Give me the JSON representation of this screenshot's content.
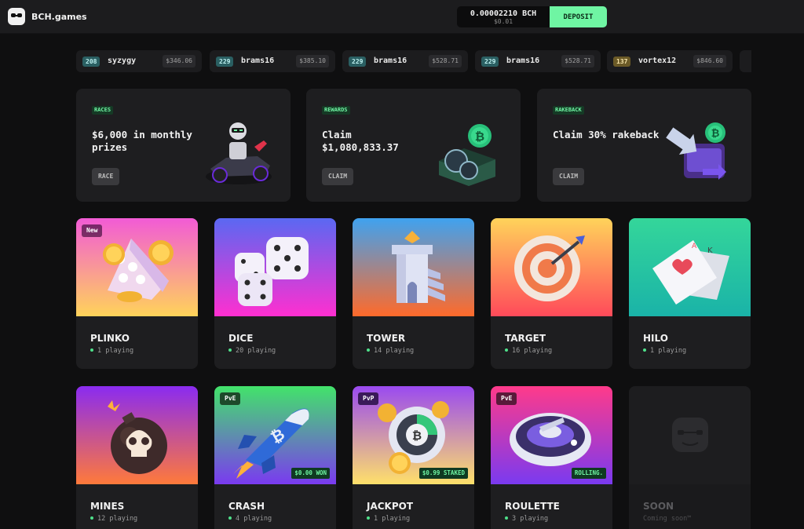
{
  "header": {
    "brand": "BCH.games",
    "balance_bch": "0.00002210 BCH",
    "balance_usd": "$0.01",
    "deposit_label": "DEPOSIT"
  },
  "ticker": [
    {
      "level": "208",
      "user": "syzygy",
      "amount": "$346.06",
      "level_color": "teal"
    },
    {
      "level": "229",
      "user": "brams16",
      "amount": "$385.10",
      "level_color": "teal"
    },
    {
      "level": "229",
      "user": "brams16",
      "amount": "$528.71",
      "level_color": "teal"
    },
    {
      "level": "229",
      "user": "brams16",
      "amount": "$528.71",
      "level_color": "teal"
    },
    {
      "level": "137",
      "user": "vortex12",
      "amount": "$846.60",
      "level_color": "gold"
    }
  ],
  "promos": [
    {
      "tag": "RACES",
      "title": "$6,000 in monthly prizes",
      "button": "RACE",
      "icon": "kart-robot-icon"
    },
    {
      "tag": "REWARDS",
      "title": "Claim $1,080,833.37",
      "button": "CLAIM",
      "icon": "coin-chest-icon"
    },
    {
      "tag": "RAKEBACK",
      "title": "Claim 30% rakeback",
      "button": "CLAIM",
      "icon": "wallet-arrow-icon"
    }
  ],
  "games": [
    {
      "name": "PLINKO",
      "playing": "1 playing",
      "badge": "New",
      "icon": "plinko-icon"
    },
    {
      "name": "DICE",
      "playing": "20 playing",
      "icon": "dice-icon"
    },
    {
      "name": "TOWER",
      "playing": "14 playing",
      "icon": "tower-icon"
    },
    {
      "name": "TARGET",
      "playing": "16 playing",
      "icon": "target-icon"
    },
    {
      "name": "HILO",
      "playing": "1 playing",
      "icon": "cards-icon"
    },
    {
      "name": "MINES",
      "playing": "12 playing",
      "icon": "bomb-icon"
    },
    {
      "name": "CRASH",
      "playing": "4 playing",
      "badge": "PvE",
      "status": "$0.00 WON",
      "icon": "rocket-icon"
    },
    {
      "name": "JACKPOT",
      "playing": "1 playing",
      "badge": "PvP",
      "status": "$0.99 STAKED",
      "icon": "jackpot-coin-icon"
    },
    {
      "name": "ROULETTE",
      "playing": "3 playing",
      "badge": "PvE",
      "status": "ROLLING.",
      "icon": "roulette-icon"
    },
    {
      "name": "SOON",
      "playing": "Coming soon™",
      "icon": "gamepad-logo-icon"
    }
  ],
  "colors": {
    "accent": "#6ff5a3",
    "background": "#0f0f10",
    "card": "#1e1e20"
  }
}
